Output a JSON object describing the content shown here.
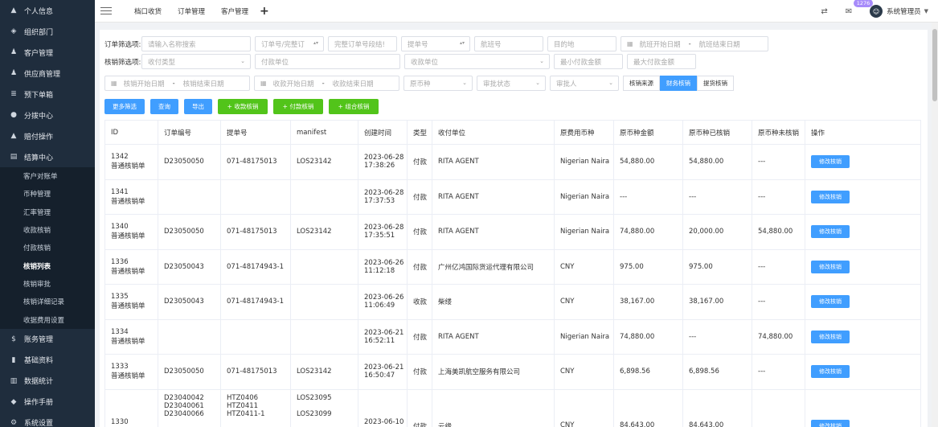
{
  "sidebar": {
    "items": [
      {
        "label": "个人信息",
        "icon": "person-icon"
      },
      {
        "label": "组织部门",
        "icon": "org-icon"
      },
      {
        "label": "客户管理",
        "icon": "users-icon"
      },
      {
        "label": "供应商管理",
        "icon": "supplier-icon"
      },
      {
        "label": "预下单箱",
        "icon": "list-icon"
      },
      {
        "label": "分拨中心",
        "icon": "location-icon"
      },
      {
        "label": "赔付操作",
        "icon": "warning-icon"
      },
      {
        "label": "结算中心",
        "icon": "document-icon"
      }
    ],
    "sub_items": [
      "客户对账单",
      "币种管理",
      "汇率管理",
      "收款核销",
      "付款核销",
      "核销列表",
      "核销审批",
      "核销详细记录",
      "收据费用设置"
    ],
    "active_sub": "核销列表",
    "bottom_items": [
      {
        "label": "账务管理",
        "icon": "dollar-icon"
      },
      {
        "label": "基础资料",
        "icon": "file-icon"
      },
      {
        "label": "数据统计",
        "icon": "stats-icon"
      },
      {
        "label": "操作手册",
        "icon": "tag-icon"
      },
      {
        "label": "系统设置",
        "icon": "gear-icon"
      }
    ]
  },
  "topbar": {
    "tabs": [
      "档口收货",
      "订单管理",
      "客户管理"
    ],
    "plus": "+",
    "badge": "1276",
    "username": "系统管理员",
    "caret": "▼"
  },
  "filters": {
    "row1_label": "订单筛选项:",
    "row1": {
      "name": "请输入名称搜索",
      "order_no": "订单号/完整订",
      "full_order": "完整订单号段结!",
      "bill_no": "提单号",
      "flight": "航班号",
      "dest": "目的地",
      "flight_start": "航班开始日期",
      "flight_end": "航班结束日期"
    },
    "row2_label": "核销筛选项:",
    "row2": {
      "pay_type": "收付类型",
      "pay_unit": "付款单位",
      "recv_unit": "收款单位",
      "min_amount": "最小付款金额",
      "max_amount": "最大付款金额"
    },
    "row3": {
      "verify_start": "核销开始日期",
      "verify_end": "核销结束日期",
      "recv_start": "收款开始日期",
      "recv_end": "收款结束日期",
      "currency": "原币种",
      "audit_status": "审批状态",
      "auditor": "审批人"
    },
    "seg": [
      "核销来源",
      "财务核销",
      "提货核销"
    ],
    "seg_active": "财务核销",
    "dash": "-"
  },
  "buttons": {
    "more": "更多筛选",
    "query": "查询",
    "export": "导出",
    "recv_verify": "+ 收款核销",
    "pay_verify": "+ 付款核销",
    "combo_verify": "+ 组合核销"
  },
  "table": {
    "columns": [
      "ID",
      "订单编号",
      "提单号",
      "manifest",
      "创建时间",
      "类型",
      "收付单位",
      "原费用币种",
      "原币种金额",
      "原币种已核销",
      "原币种未核销",
      "操作"
    ],
    "action_label": "修改核销",
    "rows": [
      {
        "id": "1342",
        "sub": "普通核销单",
        "order": "D23050050",
        "bill": "071-48175013",
        "manifest": "LOS23142",
        "date": "2023-06-28",
        "time": "17:38:26",
        "type": "付款",
        "unit": "RITA AGENT",
        "currency": "Nigerian Naira",
        "amount": "54,880.00",
        "verified": "54,880.00",
        "unverified": "---"
      },
      {
        "id": "1341",
        "sub": "普通核销单",
        "order": "",
        "bill": "",
        "manifest": "",
        "date": "2023-06-28",
        "time": "17:37:53",
        "type": "付款",
        "unit": "RITA AGENT",
        "currency": "Nigerian Naira",
        "amount": "---",
        "verified": "---",
        "unverified": "---"
      },
      {
        "id": "1340",
        "sub": "普通核销单",
        "order": "D23050050",
        "bill": "071-48175013",
        "manifest": "LOS23142",
        "date": "2023-06-28",
        "time": "17:35:51",
        "type": "付款",
        "unit": "RITA AGENT",
        "currency": "Nigerian Naira",
        "amount": "74,880.00",
        "verified": "20,000.00",
        "unverified": "54,880.00"
      },
      {
        "id": "1336",
        "sub": "普通核销单",
        "order": "D23050043",
        "bill": "071-48174943-1",
        "manifest": "",
        "date": "2023-06-26",
        "time": "11:12:18",
        "type": "付款",
        "unit": "广州亿鸿国际货运代理有限公司",
        "currency": "CNY",
        "amount": "975.00",
        "verified": "975.00",
        "unverified": "---"
      },
      {
        "id": "1335",
        "sub": "普通核销单",
        "order": "D23050043",
        "bill": "071-48174943-1",
        "manifest": "",
        "date": "2023-06-26",
        "time": "11:06:49",
        "type": "收款",
        "unit": "柴缕",
        "currency": "CNY",
        "amount": "38,167.00",
        "verified": "38,167.00",
        "unverified": "---"
      },
      {
        "id": "1334",
        "sub": "普通核销单",
        "order": "",
        "bill": "",
        "manifest": "",
        "date": "2023-06-21",
        "time": "16:52:11",
        "type": "付款",
        "unit": "RITA AGENT",
        "currency": "Nigerian Naira",
        "amount": "74,880.00",
        "verified": "---",
        "unverified": "74,880.00"
      },
      {
        "id": "1333",
        "sub": "普通核销单",
        "order": "D23050050",
        "bill": "071-48175013",
        "manifest": "LOS23142",
        "date": "2023-06-21",
        "time": "16:50:47",
        "type": "付款",
        "unit": "上海美凯航空服务有限公司",
        "currency": "CNY",
        "amount": "6,898.56",
        "verified": "6,898.56",
        "unverified": "---"
      }
    ],
    "last_row": {
      "id": "1330",
      "orders": [
        "D23040042",
        "D23040061",
        "D23040066"
      ],
      "bills": [
        "HTZ0406",
        "HTZ0411",
        "HTZ0411-1"
      ],
      "manifests": [
        "LOS23095",
        "LOS23099"
      ],
      "date": "2023-06-10",
      "type": "付款",
      "unit": "云缘",
      "currency": "CNY",
      "amount": "84,643.00",
      "verified": "84,643.00"
    }
  }
}
